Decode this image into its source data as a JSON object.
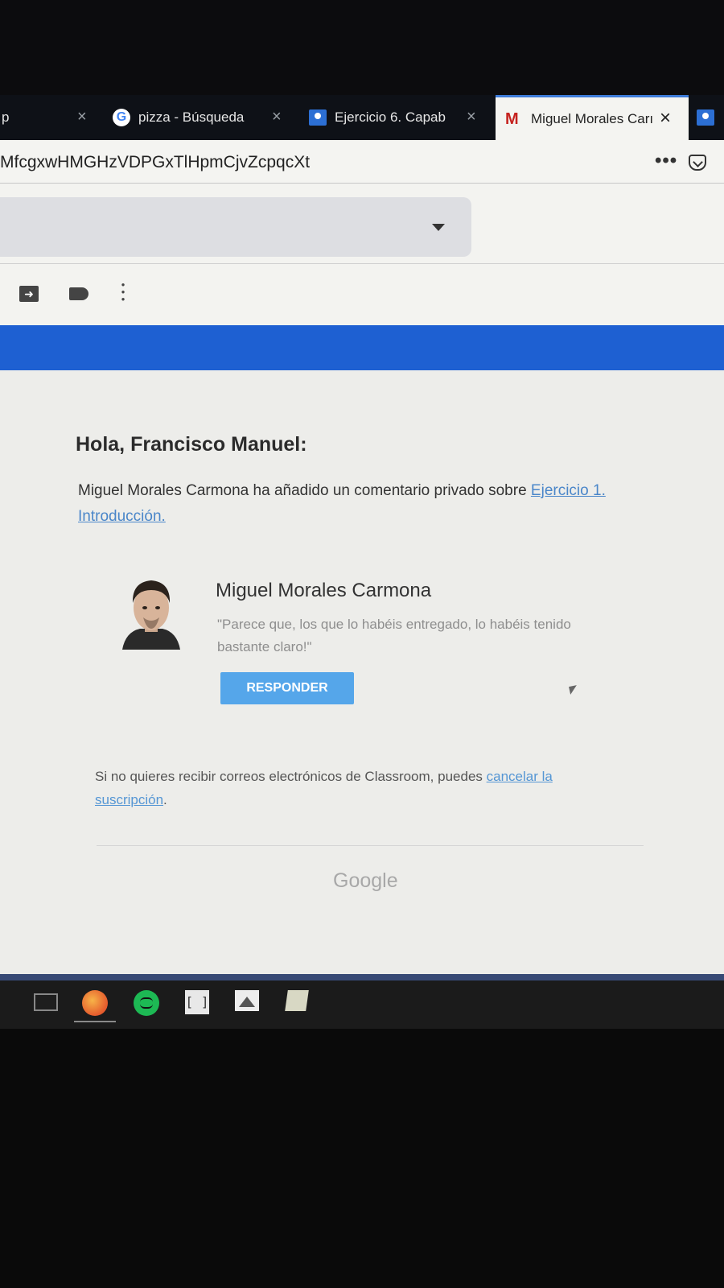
{
  "browser": {
    "tabs": [
      {
        "title": "p",
        "active": false
      },
      {
        "title": "pizza - Búsqueda",
        "active": false
      },
      {
        "title": "Ejercicio 6. Capab",
        "active": false
      },
      {
        "title": "Miguel Morales Carı",
        "active": true
      }
    ],
    "url_fragment": "MfcgxwHMGHzVDPGxTlHpmCjvZcpqcXt",
    "more_label": "•••"
  },
  "email": {
    "greeting": "Hola, Francisco Manuel:",
    "intro_text": "Miguel Morales Carmona ha añadido un comentario privado sobre ",
    "intro_link": "Ejercicio 1. Introducción.",
    "commenter_name": "Miguel Morales Carmona",
    "comment": "\"Parece que, los que lo habéis entregado, lo habéis tenido bastante claro!\"",
    "reply_button": "RESPONDER",
    "unsubscribe_text": "Si no quieres recibir correos electrónicos de Classroom, puedes ",
    "unsubscribe_link": "cancelar la suscripción",
    "unsubscribe_end": ".",
    "footer_logo": "Google"
  },
  "colors": {
    "banner": "#1e60d2",
    "button": "#55a6ea",
    "link": "#4a86c9"
  }
}
